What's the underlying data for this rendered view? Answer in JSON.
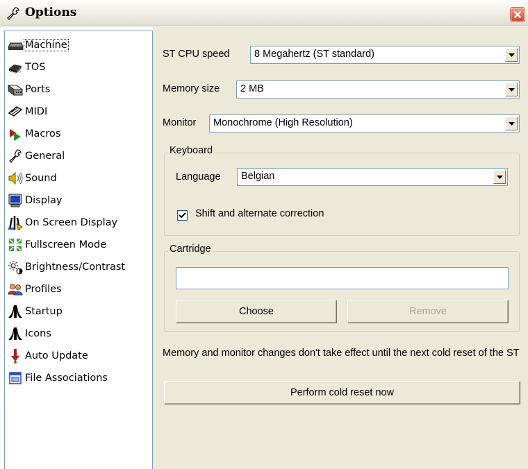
{
  "window": {
    "title": "Options"
  },
  "sidebar": {
    "items": [
      {
        "label": "Machine",
        "icon": "machine-icon"
      },
      {
        "label": "TOS",
        "icon": "tos-chip-icon"
      },
      {
        "label": "Ports",
        "icon": "ports-icon"
      },
      {
        "label": "MIDI",
        "icon": "midi-icon"
      },
      {
        "label": "Macros",
        "icon": "macros-icon"
      },
      {
        "label": "General",
        "icon": "wrench-icon"
      },
      {
        "label": "Sound",
        "icon": "speaker-icon"
      },
      {
        "label": "Display",
        "icon": "monitor-icon"
      },
      {
        "label": "On Screen Display",
        "icon": "osd-icon"
      },
      {
        "label": "Fullscreen Mode",
        "icon": "fullscreen-icon"
      },
      {
        "label": "Brightness/Contrast",
        "icon": "brightness-icon"
      },
      {
        "label": "Profiles",
        "icon": "profiles-icon"
      },
      {
        "label": "Startup",
        "icon": "atari-logo-icon"
      },
      {
        "label": "Icons",
        "icon": "atari-logo-icon"
      },
      {
        "label": "Auto Update",
        "icon": "auto-update-icon"
      },
      {
        "label": "File Associations",
        "icon": "file-associations-icon"
      }
    ],
    "selected": "Machine"
  },
  "machine": {
    "cpu_label": "ST CPU speed",
    "cpu_value": "8 Megahertz (ST standard)",
    "memory_label": "Memory size",
    "memory_value": "2 MB",
    "monitor_label": "Monitor",
    "monitor_value": "Monochrome (High Resolution)",
    "keyboard": {
      "title": "Keyboard",
      "language_label": "Language",
      "language_value": "Belgian",
      "shift_correction_label": "Shift and alternate correction",
      "shift_correction_checked": true
    },
    "cartridge": {
      "title": "Cartridge",
      "path_value": "",
      "choose_label": "Choose",
      "remove_label": "Remove"
    },
    "note": "Memory and monitor changes don't take effect until the next cold reset of the ST",
    "cold_reset_label": "Perform cold reset now"
  },
  "colors": {
    "panel_bg": "#ece9d8",
    "field_border": "#7f9db9",
    "close_button": "#d2462a"
  }
}
